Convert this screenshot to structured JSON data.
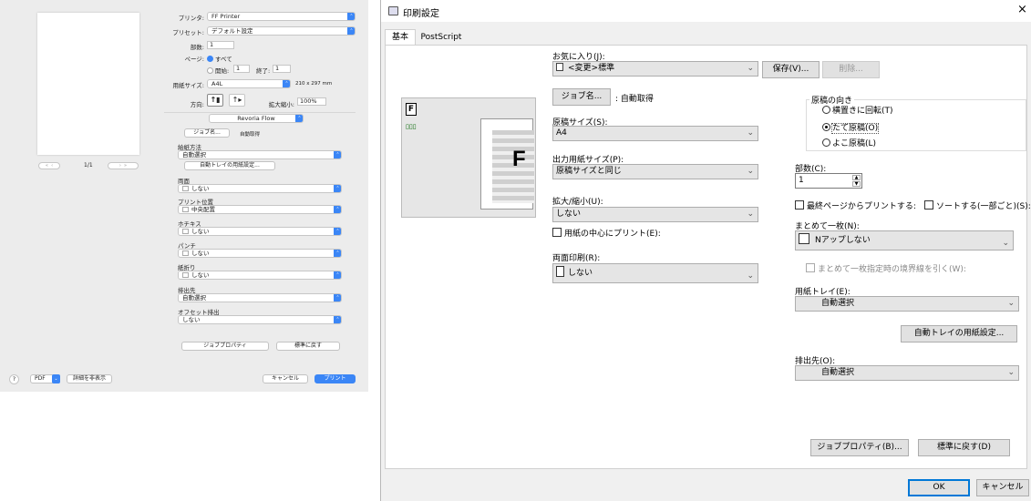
{
  "mac": {
    "printer_label": "プリンタ:",
    "printer_value": "FF Printer",
    "preset_label": "プリセット:",
    "preset_value": "デフォルト設定",
    "copies_label": "部数:",
    "copies_value": "1",
    "pages_label": "ページ:",
    "pages_all": "すべて",
    "pages_from_label": "開始:",
    "pages_from_value": "1",
    "pages_to_label": "終了:",
    "pages_to_value": "1",
    "paper_label": "用紙サイズ:",
    "paper_value": "A4L",
    "paper_dims": "210 x 297 mm",
    "orientation_label": "方向:",
    "scale_label": "拡大縮小:",
    "scale_value": "100%",
    "panel_value": "Revoria Flow",
    "job_name_button": "ジョブ名...",
    "job_name_value": "自動取得",
    "paper_method_label": "給紙方法",
    "paper_method_value": "自動選択",
    "auto_tray_button": "自動トレイの用紙設定...",
    "duplex_label": "両面",
    "duplex_value": "しない",
    "print_position_label": "プリント位置",
    "print_position_value": "中央配置",
    "staple_label": "ホチキス",
    "staple_value": "しない",
    "punch_label": "パンチ",
    "punch_value": "しない",
    "fold_label": "紙折り",
    "fold_value": "しない",
    "output_label": "排出先",
    "output_value": "自動選択",
    "offset_label": "オフセット排出",
    "offset_value": "しない",
    "job_props_button": "ジョブプロパティ",
    "restore_button": "標準に戻す",
    "page_counter": "1/1",
    "help_label": "?",
    "pdf_label": "PDF",
    "hide_details": "詳細を非表示",
    "cancel_button": "キャンセル",
    "print_button": "プリント"
  },
  "win": {
    "title": "印刷設定",
    "close": "×",
    "tabs": [
      "基本",
      "PostScript"
    ],
    "favorites_label": "お気に入り(J):",
    "favorites_value": "<変更>標準",
    "save_button": "保存(V)...",
    "delete_button": "削除...",
    "job_name_button": "ジョブ名...",
    "job_name_value": ": 自動取得",
    "original_size_label": "原稿サイズ(S):",
    "original_size_value": "A4",
    "output_size_label": "出力用紙サイズ(P):",
    "output_size_value": "原稿サイズと同じ",
    "scale_label": "拡大/縮小(U):",
    "scale_value": "しない",
    "center_print_label": "用紙の中心にプリント(E):",
    "duplex_label": "両面印刷(R):",
    "duplex_value": "しない",
    "orientation_label": "原稿の向き",
    "orient_rotate": "横置きに回転(T)",
    "orient_portrait": "たて原稿(O)",
    "orient_landscape": "よこ原稿(L)",
    "copies_label": "部数(C):",
    "copies_value": "1",
    "last_page_label": "最終ページからプリントする:",
    "sort_label": "ソートする(一部ごと)(S):",
    "nup_label": "まとめて一枚(N):",
    "nup_value": "Nアップしない",
    "nup_border_label": "まとめて一枚指定時の境界線を引く(W):",
    "tray_label": "用紙トレイ(E):",
    "tray_value": "自動選択",
    "auto_tray_button": "自動トレイの用紙設定...",
    "output_label": "排出先(O):",
    "output_value": "自動選択",
    "job_props_button": "ジョブプロパティ(B)...",
    "restore_button": "標準に戻す(D)",
    "ok_button": "OK",
    "cancel_button": "キャンセル",
    "preview_letter": "F"
  },
  "colors": {
    "mac_accent": "#3b86f6",
    "win_ok_border": "#0078d7"
  }
}
